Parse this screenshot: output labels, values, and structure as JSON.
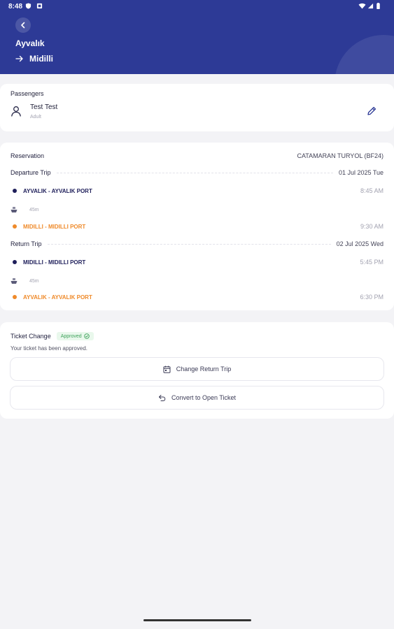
{
  "status_bar": {
    "time": "8:48"
  },
  "header": {
    "from": "Ayvalık",
    "to": "Midilli"
  },
  "passengers": {
    "title": "Passengers",
    "items": [
      {
        "name": "Test Test",
        "type": "Adult"
      }
    ]
  },
  "reservation": {
    "title": "Reservation",
    "vessel": "CATAMARAN TURYOL (BF24)",
    "departure": {
      "label": "Departure Trip",
      "date": "01 Jul 2025 Tue",
      "from_port": "AYVALIK - AYVALIK PORT",
      "from_time": "8:45 AM",
      "duration": "45m",
      "to_port": "MIDILLI - MIDILLI PORT",
      "to_time": "9:30 AM"
    },
    "return": {
      "label": "Return Trip",
      "date": "02 Jul 2025 Wed",
      "from_port": "MIDILLI - MIDILLI PORT",
      "from_time": "5:45 PM",
      "duration": "45m",
      "to_port": "AYVALIK - AYVALIK PORT",
      "to_time": "6:30 PM"
    }
  },
  "ticket_change": {
    "title": "Ticket Change",
    "badge": "Approved",
    "message": "Your ticket has been approved.",
    "change_return_label": "Change Return Trip",
    "open_ticket_label": "Convert to Open Ticket"
  },
  "colors": {
    "primary": "#2d3a96",
    "origin_dot": "#1e1e5a",
    "destination": "#ef8a2a",
    "approved": "#3ea25a"
  }
}
